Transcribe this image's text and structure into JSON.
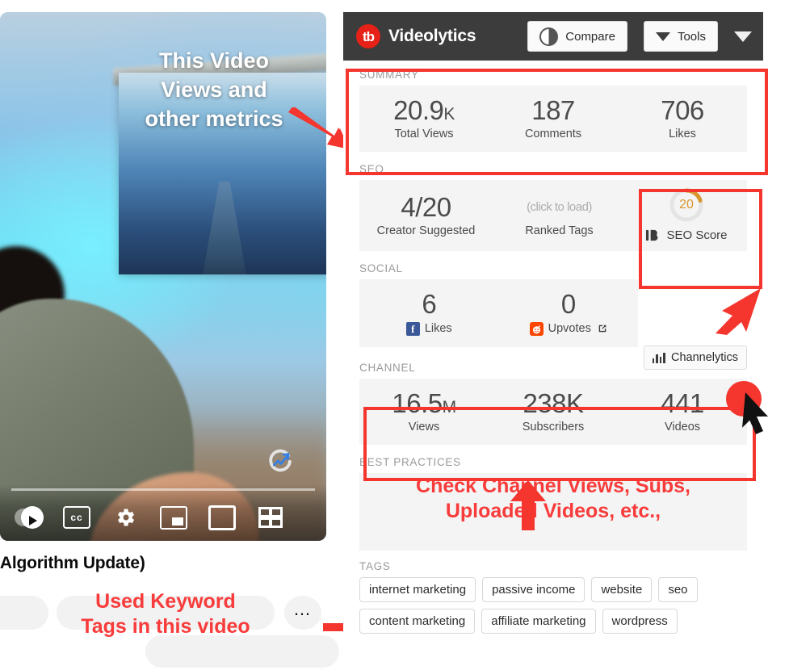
{
  "video": {
    "title_visible": "oogle Algorithm Update)",
    "annotation_top": "This Video\nViews and\nother metrics",
    "annotation_bottom": "Used Keyword\nTags in this video",
    "controls": [
      {
        "name": "autoplay-toggle",
        "label": ""
      },
      {
        "name": "captions-button",
        "label": "CC"
      },
      {
        "name": "settings-button",
        "label": ""
      },
      {
        "name": "miniplayer-button",
        "label": ""
      },
      {
        "name": "theater-button",
        "label": ""
      },
      {
        "name": "fullscreen-button",
        "label": ""
      }
    ],
    "more_actions_label": "…"
  },
  "panel": {
    "header": {
      "logo_glyph": "tb",
      "title": "Videolytics",
      "compare_label": "Compare",
      "tools_label": "Tools"
    },
    "summary": {
      "section_label": "SUMMARY",
      "stats": [
        {
          "value": "20.9",
          "suffix": "K",
          "caption": "Total Views"
        },
        {
          "value": "187",
          "suffix": "",
          "caption": "Comments"
        },
        {
          "value": "706",
          "suffix": "",
          "caption": "Likes"
        }
      ]
    },
    "seo": {
      "section_label": "SEO",
      "stats": [
        {
          "value": "4/20",
          "caption": "Creator Suggested"
        },
        {
          "value": "(click to load)",
          "caption": "Ranked Tags"
        }
      ],
      "score": {
        "value": "20",
        "label": "SEO Score",
        "percent": 20,
        "color": "#d8962f"
      }
    },
    "social": {
      "section_label": "SOCIAL",
      "stats": [
        {
          "value": "6",
          "caption": "Likes",
          "icon": "facebook-icon"
        },
        {
          "value": "0",
          "caption": "Upvotes",
          "icon": "reddit-icon"
        }
      ]
    },
    "channel": {
      "section_label": "CHANNEL",
      "channelytics_label": "Channelytics",
      "stats": [
        {
          "value": "16.5",
          "suffix": "M",
          "caption": "Views"
        },
        {
          "value": "238K",
          "suffix": "",
          "caption": "Subscribers"
        },
        {
          "value": "441",
          "suffix": "",
          "caption": "Videos"
        }
      ]
    },
    "best_practices": {
      "section_label": "BEST PRACTICES",
      "annotation": "Check Channel Views, Subs,\nUploaded Videos, etc.,"
    },
    "tags": {
      "section_label": "TAGS",
      "items": [
        "internet marketing",
        "passive income",
        "website",
        "seo",
        "content marketing",
        "affiliate marketing",
        "wordpress"
      ]
    }
  },
  "colors": {
    "accent_red": "#f4362e",
    "annotation_red": "#f83b3b",
    "brand_red": "#e62117",
    "header_bg": "#3c3c3c",
    "card_bg": "#f4f4f4",
    "gauge_orange": "#d8962f"
  }
}
